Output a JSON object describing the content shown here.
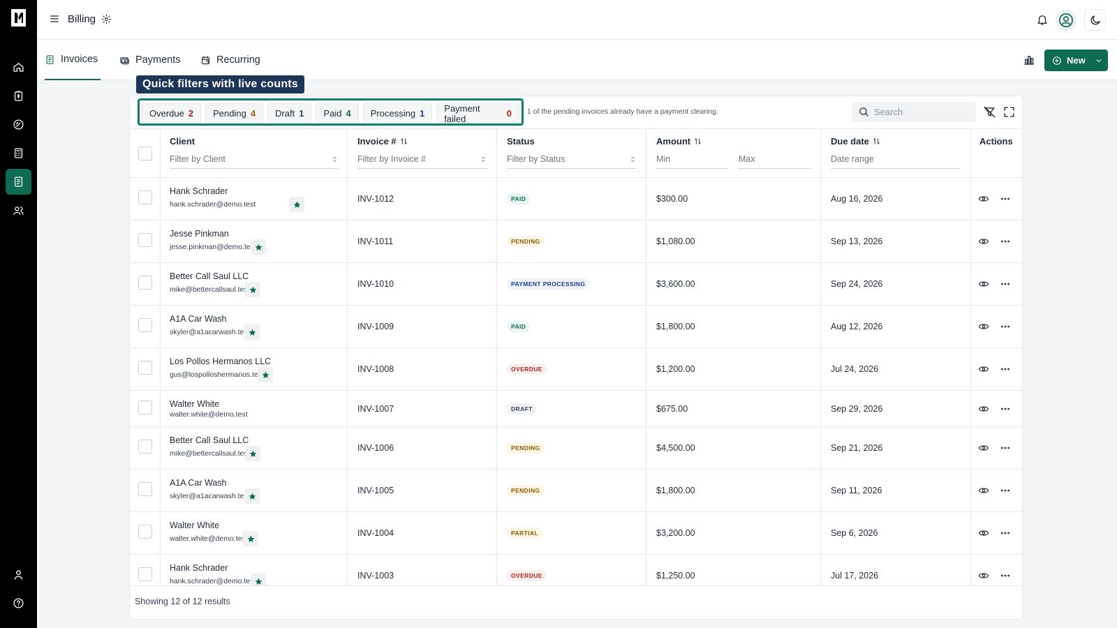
{
  "app": {
    "title": "Billing"
  },
  "rail": {
    "items": [
      {
        "name": "home",
        "active": false
      },
      {
        "name": "clipboard",
        "active": false
      },
      {
        "name": "gauge",
        "active": false
      },
      {
        "name": "calculator",
        "active": false
      },
      {
        "name": "invoices",
        "active": true
      },
      {
        "name": "users",
        "active": false
      }
    ],
    "bottom": [
      "account",
      "help"
    ]
  },
  "tabs": [
    {
      "label": "Invoices",
      "active": true,
      "icon": "invoice-icon"
    },
    {
      "label": "Payments",
      "active": false,
      "icon": "payments-icon"
    },
    {
      "label": "Recurring",
      "active": false,
      "icon": "calendar-icon"
    }
  ],
  "toolbar": {
    "new_label": "New"
  },
  "callout": "Quick filters with live counts",
  "quick_filters": [
    {
      "label": "Overdue",
      "count": "2",
      "kind": "overdue"
    },
    {
      "label": "Pending",
      "count": "4",
      "kind": "pending"
    },
    {
      "label": "Draft",
      "count": "1",
      "kind": "draft"
    },
    {
      "label": "Paid",
      "count": "4",
      "kind": "paid"
    },
    {
      "label": "Processing",
      "count": "1",
      "kind": "processing"
    },
    {
      "label": "Payment failed",
      "count": "0",
      "kind": "failed"
    }
  ],
  "filter_note": "1 of the pending invoices already have a payment clearing.",
  "search": {
    "placeholder": "Search"
  },
  "columns": {
    "client": {
      "label": "Client",
      "filter": "Filter by Client"
    },
    "invoice": {
      "label": "Invoice #",
      "filter": "Filter by Invoice #"
    },
    "status": {
      "label": "Status",
      "filter": "Filter by Status"
    },
    "amount": {
      "label": "Amount",
      "min": "Min",
      "max": "Max"
    },
    "due": {
      "label": "Due date",
      "filter": "Date range"
    },
    "actions": {
      "label": "Actions"
    }
  },
  "rows": [
    {
      "client": "Hank Schrader",
      "email": "hank.schrader@demo.test",
      "starred": true,
      "invoice": "INV-1012",
      "status": "PAID",
      "status_kind": "paid",
      "amount": "$300.00",
      "due": "Aug 16, 2026"
    },
    {
      "client": "Jesse Pinkman",
      "email": "jesse.pinkman@demo.test",
      "starred": true,
      "invoice": "INV-1011",
      "status": "PENDING",
      "status_kind": "pending",
      "amount": "$1,080.00",
      "due": "Sep 13, 2026"
    },
    {
      "client": "Better Call Saul LLC",
      "email": "mike@bettercallsaul.test",
      "starred": true,
      "invoice": "INV-1010",
      "status": "PAYMENT PROCESSING",
      "status_kind": "processing",
      "amount": "$3,600.00",
      "due": "Sep 24, 2026"
    },
    {
      "client": "A1A Car Wash",
      "email": "skyler@a1acarwash.test",
      "starred": true,
      "invoice": "INV-1009",
      "status": "PAID",
      "status_kind": "paid",
      "amount": "$1,800.00",
      "due": "Aug 12, 2026"
    },
    {
      "client": "Los Pollos Hermanos LLC",
      "email": "gus@lospolloshermanos.test",
      "starred": true,
      "invoice": "INV-1008",
      "status": "OVERDUE",
      "status_kind": "overdue",
      "amount": "$1,200.00",
      "due": "Jul 24, 2026"
    },
    {
      "client": "Walter White",
      "email": "walter.white@demo.test",
      "starred": false,
      "invoice": "INV-1007",
      "status": "DRAFT",
      "status_kind": "draft",
      "amount": "$675.00",
      "due": "Sep 29, 2026"
    },
    {
      "client": "Better Call Saul LLC",
      "email": "mike@bettercallsaul.test",
      "starred": true,
      "invoice": "INV-1006",
      "status": "PENDING",
      "status_kind": "pending",
      "amount": "$4,500.00",
      "due": "Sep 21, 2026"
    },
    {
      "client": "A1A Car Wash",
      "email": "skyler@a1acarwash.test",
      "starred": true,
      "invoice": "INV-1005",
      "status": "PENDING",
      "status_kind": "pending",
      "amount": "$1,800.00",
      "due": "Sep 11, 2026"
    },
    {
      "client": "Walter White",
      "email": "walter.white@demo.test",
      "starred": true,
      "invoice": "INV-1004",
      "status": "PARTIAL",
      "status_kind": "partial",
      "amount": "$3,200.00",
      "due": "Sep 6, 2026"
    },
    {
      "client": "Hank Schrader",
      "email": "hank.schrader@demo.test",
      "starred": true,
      "invoice": "INV-1003",
      "status": "OVERDUE",
      "status_kind": "overdue",
      "amount": "$1,250.00",
      "due": "Jul 17, 2026"
    }
  ],
  "footer": "Showing 12 of 12 results"
}
